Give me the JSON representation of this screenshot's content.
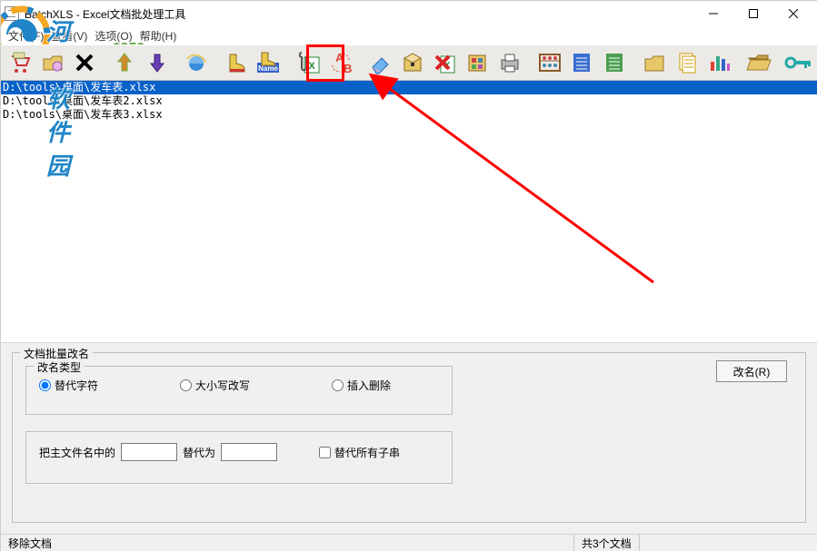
{
  "window": {
    "title": "BatchXLS - Excel文档批处理工具"
  },
  "watermark": {
    "line1": "河东软件园",
    "line2": "www.pc0359.cn"
  },
  "menu": {
    "file": "文件(F)",
    "view": "查看(V)",
    "options": "选项(O)",
    "help": "帮助(H)"
  },
  "files": [
    "D:\\tools\\桌面\\发车表.xlsx",
    "D:\\tools\\桌面\\发车表2.xlsx",
    "D:\\tools\\桌面\\发车表3.xlsx"
  ],
  "selected_index": 0,
  "panel": {
    "group_title": "文档批量改名",
    "type_group": "改名类型",
    "radio_replace": "替代字符",
    "radio_case": "大小写改写",
    "radio_insert": "插入删除",
    "rename_btn": "改名(R)",
    "prefix": "把主文件名中的",
    "mid": "替代为",
    "chk_all": "替代所有子串",
    "val1": "",
    "val2": ""
  },
  "status": {
    "left": "移除文档",
    "right": "共3个文档"
  },
  "icons": {
    "cart": "cart-icon",
    "open": "open-folder-icon",
    "close": "close-icon",
    "up": "arrow-up-icon",
    "down": "arrow-down-icon",
    "ie": "ie-icon",
    "boot": "boot-icon",
    "name": "rename-icon",
    "clip": "attach-excel-icon",
    "ab": "ab-replace-icon",
    "eraser": "eraser-icon",
    "pkg": "package-icon",
    "xdel": "delete-red-icon",
    "book": "workbook-icon",
    "print": "printer-icon",
    "calc": "abacus-icon",
    "listb": "list-blue-icon",
    "listg": "list-green-icon",
    "folder": "folder-icon",
    "sheets": "sheets-icon",
    "chart": "chart-icon",
    "fldopen": "folder-open-icon",
    "key": "key-icon"
  }
}
